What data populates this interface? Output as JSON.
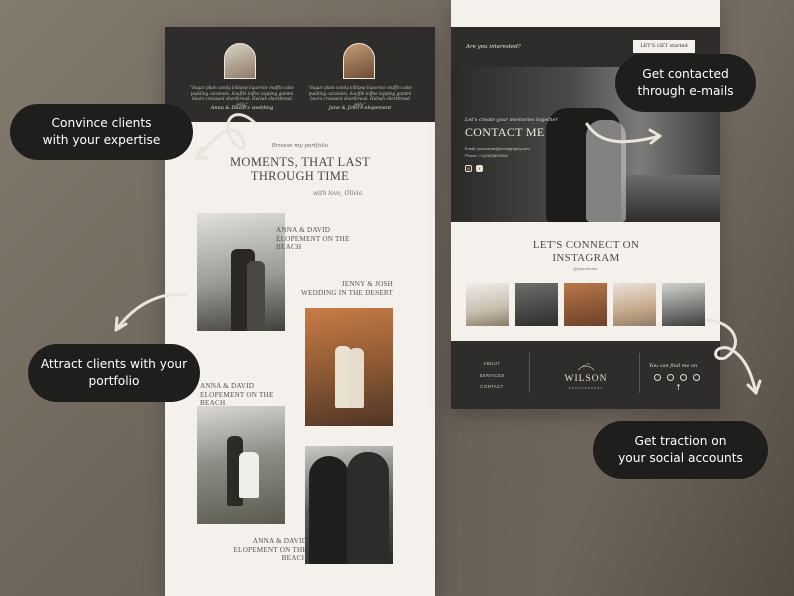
{
  "left_page": {
    "testimonials": [
      {
        "quote": "\"Sugar plum candy lollipop liquorice muffin cake pudding caramels. Soufflé toffee topping gummi bears croissant shortbread. Halvah shortbread jelly.\"",
        "name": "Anna & David's wedding"
      },
      {
        "quote": "\"Sugar plum candy lollipop liquorice muffin cake pudding caramels. Soufflé toffee topping gummi bears croissant shortbread. Halvah shortbread jelly.\"",
        "name": "Jane & John's elopement"
      }
    ],
    "browse_label": "Browse my portfolio",
    "moments_line1": "MOMENTS, THAT LAST",
    "moments_line2": "THROUGH TIME",
    "signature": "with love, Olivia",
    "captions": {
      "c1": {
        "line1": "ANNA & DAVID",
        "line2": "ELOPEMENT ON THE",
        "line3": "BEACH"
      },
      "c2": {
        "line1": "JENNY & JOSH",
        "line2": "WEDDING IN THE DESERT"
      },
      "c3": {
        "line1": "ANNA & DAVID",
        "line2": "ELOPEMENT ON THE",
        "line3": "BEACH"
      },
      "c4": {
        "line1": "ANNA & DAVID",
        "line2": "ELOPEMENT ON THE",
        "line3": "BEACH"
      }
    }
  },
  "right_page": {
    "cta_text": "Are you interested?",
    "cta_button": "LET'S GET started",
    "contact_sub": "Let's create your memories together",
    "contact_title": "CONTACT ME",
    "contact_email": "Email: yourname@photography.com",
    "contact_phone": "Phone: +1(234)5678910",
    "ig_title_line1": "LET'S CONNECT ON",
    "ig_title_line2": "INSTAGRAM",
    "ig_handle": "@yourname",
    "footer_links": [
      "ABOUT",
      "SERVICES",
      "CONTACT"
    ],
    "brand": "WILSON",
    "brand_sub": "PHOTOGRAPHY",
    "find_me": "You can find me on"
  },
  "callouts": {
    "expertise": {
      "line1": "Convince clients",
      "line2": "with your expertise"
    },
    "portfolio": {
      "line1": "Attract clients with  your",
      "line2": "portfolio"
    },
    "emails": {
      "line1": "Get contacted",
      "line2": "through e-mails"
    },
    "social": {
      "line1": "Get traction on",
      "line2": "your social accounts"
    }
  },
  "icons": {
    "social": [
      "instagram-icon",
      "facebook-icon",
      "youtube-icon",
      "pinterest-icon"
    ],
    "scroll": "arrow-up-icon"
  },
  "colors": {
    "dark": "#2e2d2b",
    "cream": "#f4f1ec",
    "callout": "#1e1e1d",
    "background": "#756c61"
  }
}
